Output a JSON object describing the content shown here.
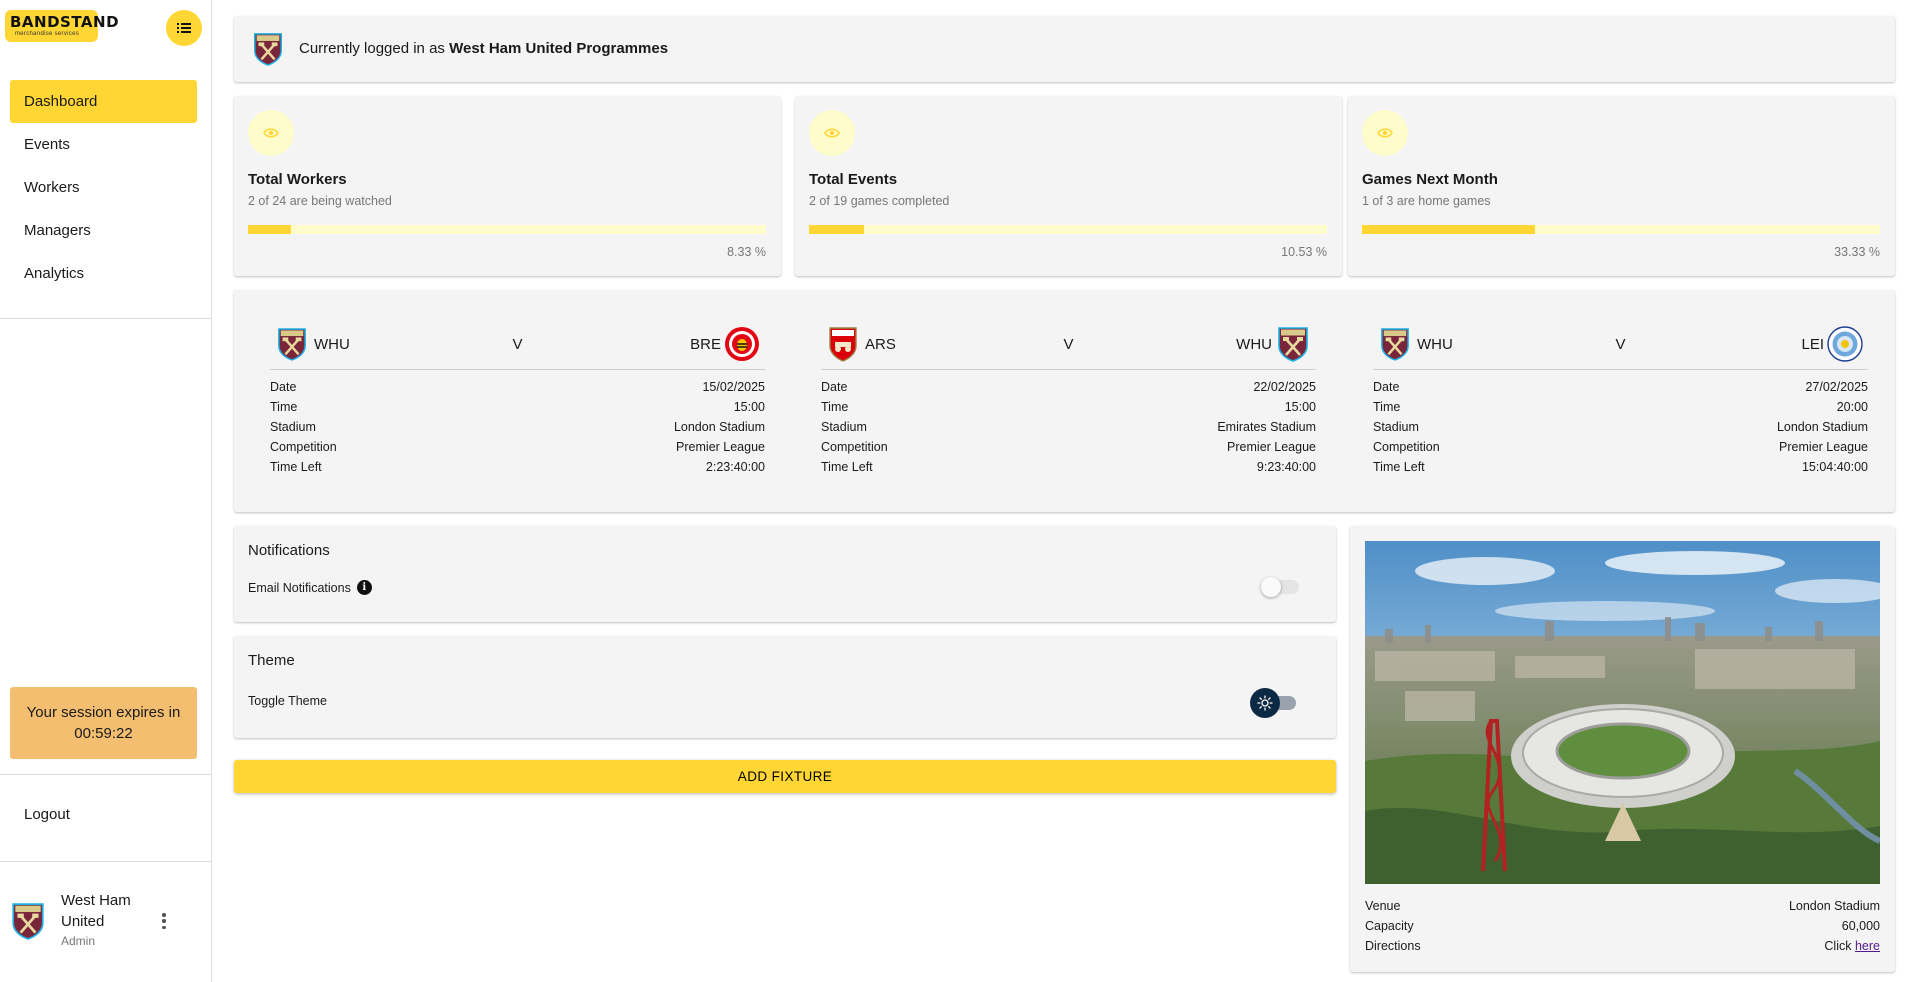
{
  "sidebar": {
    "logo_text": "BANDSTAND",
    "logo_subtext": "merchandise services",
    "nav": [
      {
        "label": "Dashboard",
        "active": true
      },
      {
        "label": "Events",
        "active": false
      },
      {
        "label": "Workers",
        "active": false
      },
      {
        "label": "Managers",
        "active": false
      },
      {
        "label": "Analytics",
        "active": false
      }
    ],
    "session_line1": "Your session expires in",
    "session_time": "00:59:22",
    "logout_label": "Logout",
    "user": {
      "name": "West Ham United",
      "role": "Admin"
    }
  },
  "topbar": {
    "prefix": "Currently logged in as ",
    "account": "West Ham United Programmes"
  },
  "stats": [
    {
      "title": "Total Workers",
      "subtitle": "2 of 24 are being watched",
      "percent_label": "8.33 %",
      "progress": 8.33
    },
    {
      "title": "Total Events",
      "subtitle": "2 of 19 games completed",
      "percent_label": "10.53 %",
      "progress": 10.53
    },
    {
      "title": "Games Next Month",
      "subtitle": "1 of 3 are home games",
      "percent_label": "33.33 %",
      "progress": 33.33
    }
  ],
  "fixtures": [
    {
      "home": "WHU",
      "away": "BRE",
      "vs": "V",
      "home_crest": "west-ham-crest",
      "away_crest": "brentford-crest",
      "rows": [
        [
          "Date",
          "15/02/2025"
        ],
        [
          "Time",
          "15:00"
        ],
        [
          "Stadium",
          "London Stadium"
        ],
        [
          "Competition",
          "Premier League"
        ],
        [
          "Time Left",
          "2:23:40:00"
        ]
      ]
    },
    {
      "home": "ARS",
      "away": "WHU",
      "vs": "V",
      "home_crest": "arsenal-crest",
      "away_crest": "west-ham-crest",
      "rows": [
        [
          "Date",
          "22/02/2025"
        ],
        [
          "Time",
          "15:00"
        ],
        [
          "Stadium",
          "Emirates Stadium"
        ],
        [
          "Competition",
          "Premier League"
        ],
        [
          "Time Left",
          "9:23:40:00"
        ]
      ]
    },
    {
      "home": "WHU",
      "away": "LEI",
      "vs": "V",
      "home_crest": "west-ham-crest",
      "away_crest": "leicester-crest",
      "rows": [
        [
          "Date",
          "27/02/2025"
        ],
        [
          "Time",
          "20:00"
        ],
        [
          "Stadium",
          "London Stadium"
        ],
        [
          "Competition",
          "Premier League"
        ],
        [
          "Time Left",
          "15:04:40:00"
        ]
      ]
    }
  ],
  "notifications": {
    "heading": "Notifications",
    "email_label": "Email Notifications",
    "email_enabled": false
  },
  "theme": {
    "heading": "Theme",
    "toggle_label": "Toggle Theme",
    "icon": "sun-icon"
  },
  "add_fixture_label": "ADD FIXTURE",
  "venue": {
    "venue_label": "Venue",
    "venue_value": "London Stadium",
    "capacity_label": "Capacity",
    "capacity_value": "60,000",
    "directions_label": "Directions",
    "directions_prefix": "Click ",
    "directions_link": "here"
  },
  "colors": {
    "accent": "#ffd633",
    "session_bg": "#f3be6f",
    "card_bg": "#f4f4f4",
    "claret": "#7a263a",
    "sky": "#1bb1e7"
  }
}
